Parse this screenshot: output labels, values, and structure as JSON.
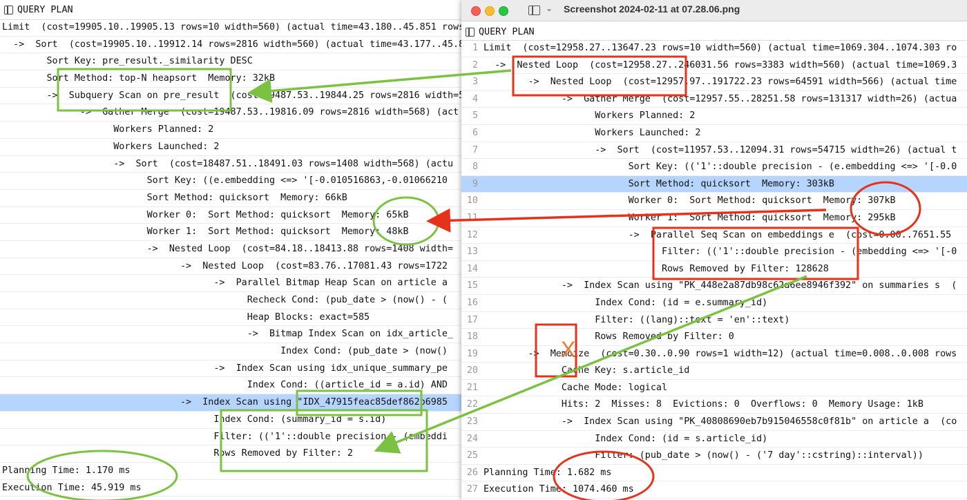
{
  "left_pane": {
    "header": "QUERY PLAN",
    "rows": [
      "Limit  (cost=19905.10..19905.13 rows=10 width=560) (actual time=43.180..45.851 rows=",
      "  ->  Sort  (cost=19905.10..19912.14 rows=2816 width=560) (actual time=43.177..45.8",
      "        Sort Key: pre_result._similarity DESC",
      "        Sort Method: top-N heapsort  Memory: 32kB",
      "        ->  Subquery Scan on pre_result  (cost=19487.53..19844.25 rows=2816 width=5",
      "              ->  Gather Merge  (cost=19487.53..19816.09 rows=2816 width=568) (act",
      "                    Workers Planned: 2",
      "                    Workers Launched: 2",
      "                    ->  Sort  (cost=18487.51..18491.03 rows=1408 width=568) (actu",
      "                          Sort Key: ((e.embedding <=> '[-0.010516863,-0.01066210",
      "                          Sort Method: quicksort  Memory: 66kB",
      "                          Worker 0:  Sort Method: quicksort  Memory: 65kB",
      "                          Worker 1:  Sort Method: quicksort  Memory: 48kB",
      "                          ->  Nested Loop  (cost=84.18..18413.88 rows=1408 width=",
      "                                ->  Nested Loop  (cost=83.76..17081.43 rows=1722",
      "                                      ->  Parallel Bitmap Heap Scan on article a",
      "                                            Recheck Cond: (pub_date > (now() - (",
      "                                            Heap Blocks: exact=585",
      "                                            ->  Bitmap Index Scan on idx_article_",
      "                                                  Index Cond: (pub_date > (now()",
      "                                      ->  Index Scan using idx_unique_summary_pe",
      "                                            Index Cond: ((article_id = a.id) AND",
      "                                ->  Index Scan using \"IDX_47915feac85def862b6985",
      "                                      Index Cond: (summary_id = s.id)",
      "                                      Filter: (('1'::double precision - (embeddi",
      "                                      Rows Removed by Filter: 2",
      "Planning Time: 1.170 ms",
      "Execution Time: 45.919 ms"
    ],
    "selected_row": 22
  },
  "right_window": {
    "title": "Screenshot 2024-02-11 at 07.28.06.png",
    "chevron": "⌄",
    "header": "QUERY PLAN",
    "rows": [
      {
        "n": "1",
        "t": "Limit  (cost=12958.27..13647.23 rows=10 width=560) (actual time=1069.304..1074.303 ro"
      },
      {
        "n": "2",
        "t": "  ->  Nested Loop  (cost=12958.27..246031.56 rows=3383 width=560) (actual time=1069.3"
      },
      {
        "n": "3",
        "t": "        ->  Nested Loop  (cost=12957.97..191722.23 rows=64591 width=566) (actual time"
      },
      {
        "n": "4",
        "t": "              ->  Gather Merge  (cost=12957.55..28251.58 rows=131317 width=26) (actua"
      },
      {
        "n": "5",
        "t": "                    Workers Planned: 2"
      },
      {
        "n": "6",
        "t": "                    Workers Launched: 2"
      },
      {
        "n": "7",
        "t": "                    ->  Sort  (cost=11957.53..12094.31 rows=54715 width=26) (actual t"
      },
      {
        "n": "8",
        "t": "                          Sort Key: (('1'::double precision - (e.embedding <=> '[-0.0"
      },
      {
        "n": "9",
        "t": "                          Sort Method: quicksort  Memory: 303kB"
      },
      {
        "n": "10",
        "t": "                          Worker 0:  Sort Method: quicksort  Memory: 307kB"
      },
      {
        "n": "11",
        "t": "                          Worker 1:  Sort Method: quicksort  Memory: 295kB"
      },
      {
        "n": "12",
        "t": "                          ->  Parallel Seq Scan on embeddings e  (cost=0.00..7651.55"
      },
      {
        "n": "13",
        "t": "                                Filter: (('1'::double precision - (embedding <=> '[-0"
      },
      {
        "n": "14",
        "t": "                                Rows Removed by Filter: 128628"
      },
      {
        "n": "15",
        "t": "              ->  Index Scan using \"PK_448e2a87db98c62a6ee8946f392\" on summaries s  ("
      },
      {
        "n": "16",
        "t": "                    Index Cond: (id = e.summary_id)"
      },
      {
        "n": "17",
        "t": "                    Filter: ((lang)::text = 'en'::text)"
      },
      {
        "n": "18",
        "t": "                    Rows Removed by Filter: 0"
      },
      {
        "n": "19",
        "t": "        ->  Memoize  (cost=0.30..0.90 rows=1 width=12) (actual time=0.008..0.008 rows"
      },
      {
        "n": "20",
        "t": "              Cache Key: s.article_id"
      },
      {
        "n": "21",
        "t": "              Cache Mode: logical"
      },
      {
        "n": "22",
        "t": "              Hits: 2  Misses: 8  Evictions: 0  Overflows: 0  Memory Usage: 1kB"
      },
      {
        "n": "23",
        "t": "              ->  Index Scan using \"PK_40808690eb7b915046558c0f81b\" on article a  (co"
      },
      {
        "n": "24",
        "t": "                    Index Cond: (id = s.article_id)"
      },
      {
        "n": "25",
        "t": "                    Filter: (pub_date > (now() - ('7 day'::cstring)::interval))"
      },
      {
        "n": "26",
        "t": "Planning Time: 1.682 ms"
      },
      {
        "n": "27",
        "t": "Execution Time: 1074.460 ms"
      }
    ],
    "selected_row": 8
  },
  "annotations": {
    "cross_mark": "X",
    "colors": {
      "green": "#7cc242",
      "red": "#e8311a",
      "orange": "#f07830",
      "selection": "#b5d5ff"
    }
  }
}
